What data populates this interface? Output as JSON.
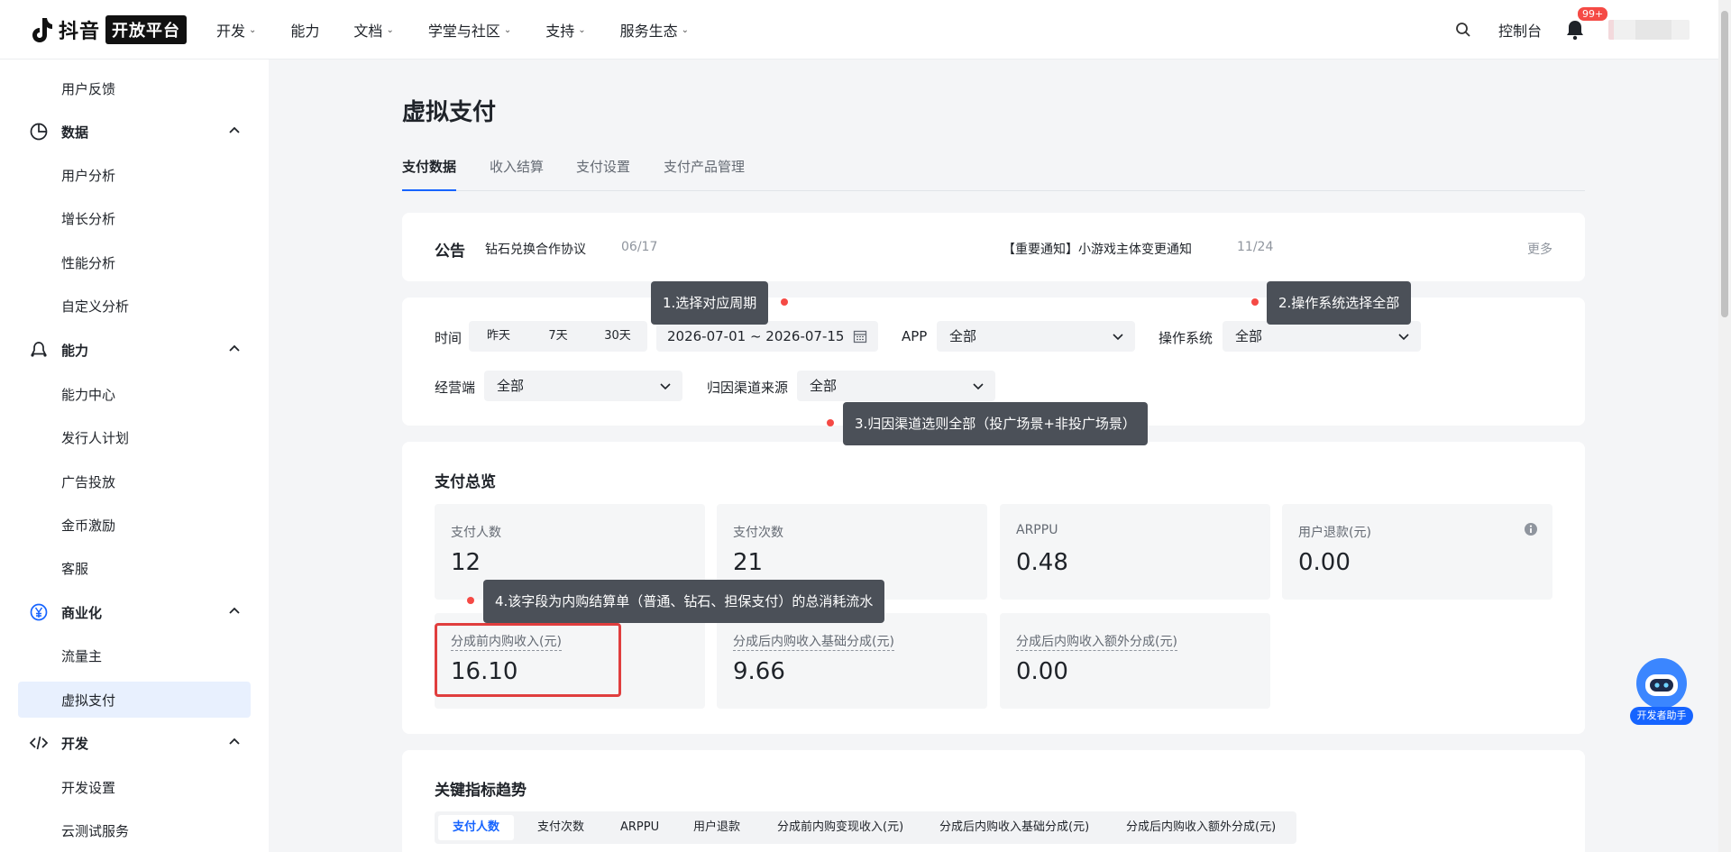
{
  "header": {
    "logo_text": "抖音",
    "logo_badge": "开放平台",
    "nav": [
      {
        "label": "开发",
        "has_dropdown": true
      },
      {
        "label": "能力",
        "has_dropdown": false
      },
      {
        "label": "文档",
        "has_dropdown": true
      },
      {
        "label": "学堂与社区",
        "has_dropdown": true
      },
      {
        "label": "支持",
        "has_dropdown": true
      },
      {
        "label": "服务生态",
        "has_dropdown": true
      }
    ],
    "console": "控制台",
    "notification_count": "99+"
  },
  "sidebar": {
    "items": [
      {
        "type": "sub",
        "label": "用户反馈"
      },
      {
        "type": "group",
        "label": "数据",
        "icon": "pie-chart-icon"
      },
      {
        "type": "sub",
        "label": "用户分析"
      },
      {
        "type": "sub",
        "label": "增长分析"
      },
      {
        "type": "sub",
        "label": "性能分析"
      },
      {
        "type": "sub",
        "label": "自定义分析"
      },
      {
        "type": "group",
        "label": "能力",
        "icon": "capability-icon"
      },
      {
        "type": "sub",
        "label": "能力中心"
      },
      {
        "type": "sub",
        "label": "发行人计划"
      },
      {
        "type": "sub",
        "label": "广告投放"
      },
      {
        "type": "sub",
        "label": "金币激励"
      },
      {
        "type": "sub",
        "label": "客服"
      },
      {
        "type": "group",
        "label": "商业化",
        "icon": "yen-icon"
      },
      {
        "type": "sub",
        "label": "流量主"
      },
      {
        "type": "sub",
        "label": "虚拟支付",
        "active": true
      },
      {
        "type": "group",
        "label": "开发",
        "icon": "code-icon"
      },
      {
        "type": "sub",
        "label": "开发设置"
      },
      {
        "type": "sub",
        "label": "云测试服务"
      }
    ]
  },
  "page": {
    "title": "虚拟支付",
    "tabs": [
      "支付数据",
      "收入结算",
      "支付设置",
      "支付产品管理"
    ],
    "active_tab": "支付数据"
  },
  "notice": {
    "title": "公告",
    "items": [
      {
        "text": "钻石兑换合作协议",
        "date": "06/17"
      },
      {
        "text": "【重要通知】小游戏主体变更通知",
        "date": "11/24"
      }
    ],
    "more": "更多"
  },
  "filters": {
    "time_label": "时间",
    "quick_ranges": [
      "昨天",
      "7天",
      "30天"
    ],
    "date_range": "2026-07-01 ~ 2026-07-15",
    "app_label": "APP",
    "app_value": "全部",
    "os_label": "操作系统",
    "os_value": "全部",
    "channel_label": "经营端",
    "channel_value": "全部",
    "source_label": "归因渠道来源",
    "source_value": "全部"
  },
  "tooltips": {
    "t1": "1.选择对应周期",
    "t2": "2.操作系统选择全部",
    "t3": "3.归因渠道选则全部（投广场景+非投广场景）",
    "t4": "4.该字段为内购结算单（普通、钻石、担保支付）的总消耗流水"
  },
  "overview": {
    "title": "支付总览",
    "metrics": [
      {
        "label": "支付人数",
        "value": "12"
      },
      {
        "label": "支付次数",
        "value": "21"
      },
      {
        "label": "ARPPU",
        "value": "0.48"
      },
      {
        "label": "用户退款(元)",
        "value": "0.00",
        "info": true
      },
      {
        "label": "分成前内购收入(元)",
        "value": "16.10"
      },
      {
        "label": "分成后内购收入基础分成(元)",
        "value": "9.66"
      },
      {
        "label": "分成后内购收入额外分成(元)",
        "value": "0.00"
      }
    ]
  },
  "trends": {
    "title": "关键指标趋势",
    "tabs": [
      "支付人数",
      "支付次数",
      "ARPPU",
      "用户退款",
      "分成前内购变现收入(元)",
      "分成后内购收入基础分成(元)",
      "分成后内购收入额外分成(元)"
    ],
    "active": "支付人数"
  },
  "assistant": {
    "label": "开发者助手"
  },
  "colors": {
    "accent": "#1664ff",
    "highlight": "#e03e3e",
    "tooltip_bg": "#4b5058"
  }
}
